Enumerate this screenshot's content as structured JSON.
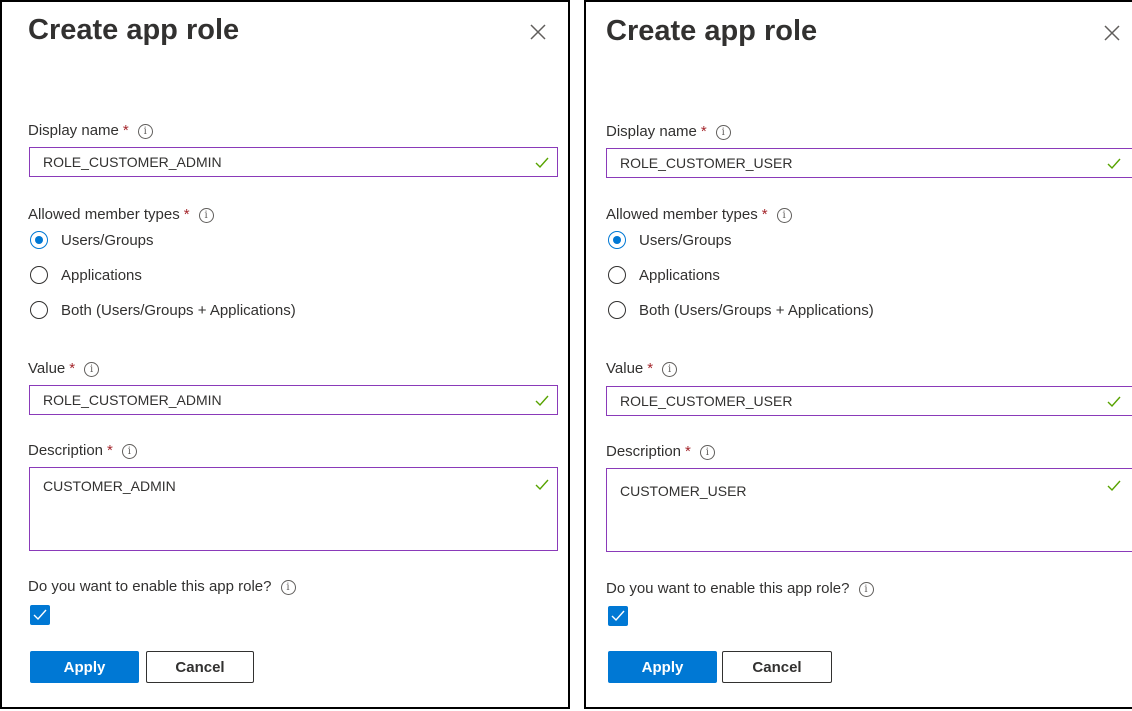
{
  "panels": [
    {
      "title": "Create app role",
      "display_name": {
        "label": "Display name",
        "required": "*",
        "info": "i",
        "value": "ROLE_CUSTOMER_ADMIN"
      },
      "member_types": {
        "label": "Allowed member types",
        "required": "*",
        "info": "i",
        "options": [
          "Users/Groups",
          "Applications",
          "Both (Users/Groups + Applications)"
        ],
        "selected": "Users/Groups"
      },
      "value_field": {
        "label": "Value",
        "required": "*",
        "info": "i",
        "value": "ROLE_CUSTOMER_ADMIN"
      },
      "description": {
        "label": "Description",
        "required": "*",
        "info": "i",
        "value": "CUSTOMER_ADMIN"
      },
      "enable": {
        "label": "Do you want to enable this app role?",
        "info": "i",
        "checked": true
      },
      "apply_label": "Apply",
      "cancel_label": "Cancel"
    },
    {
      "title": "Create app role",
      "display_name": {
        "label": "Display name",
        "required": "*",
        "info": "i",
        "value": "ROLE_CUSTOMER_USER"
      },
      "member_types": {
        "label": "Allowed member types",
        "required": "*",
        "info": "i",
        "options": [
          "Users/Groups",
          "Applications",
          "Both (Users/Groups + Applications)"
        ],
        "selected": "Users/Groups"
      },
      "value_field": {
        "label": "Value",
        "required": "*",
        "info": "i",
        "value": "ROLE_CUSTOMER_USER"
      },
      "description": {
        "label": "Description",
        "required": "*",
        "info": "i",
        "value": "CUSTOMER_USER"
      },
      "enable": {
        "label": "Do you want to enable this app role?",
        "info": "i",
        "checked": true
      },
      "apply_label": "Apply",
      "cancel_label": "Cancel"
    }
  ],
  "icons": {
    "close": "close-icon",
    "valid": "checkmark-icon",
    "info": "info-icon"
  },
  "colors": {
    "accent": "#0078d4",
    "required": "#a4262c",
    "valid": "#57a300",
    "focus_border": "#8a3ab9"
  }
}
